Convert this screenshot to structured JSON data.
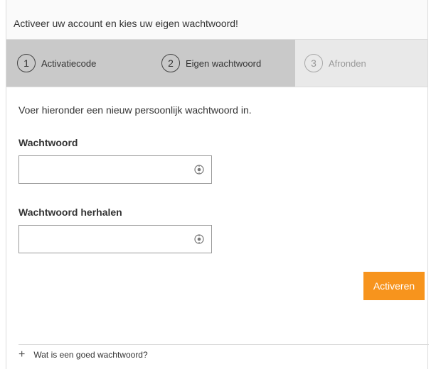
{
  "header": {
    "title": "Activeer uw account en kies uw eigen wachtwoord!"
  },
  "steps": [
    {
      "number": "1",
      "label": "Activatiecode",
      "state": "active"
    },
    {
      "number": "2",
      "label": "Eigen wachtwoord",
      "state": "active"
    },
    {
      "number": "3",
      "label": "Afronden",
      "state": "inactive"
    }
  ],
  "form": {
    "intro": "Voer hieronder een nieuw persoonlijk wachtwoord in.",
    "password_label": "Wachtwoord",
    "password_value": "",
    "password_repeat_label": "Wachtwoord herhalen",
    "password_repeat_value": "",
    "toggle_icon": "eye-icon"
  },
  "actions": {
    "activate_label": "Activeren"
  },
  "footer": {
    "faq_icon": "plus-icon",
    "faq_label": "Wat is een goed wachtwoord?"
  },
  "colors": {
    "accent": "#f7941d",
    "step_active_bg": "#c9c9c9",
    "step_inactive_bg": "#e9e9e9"
  }
}
